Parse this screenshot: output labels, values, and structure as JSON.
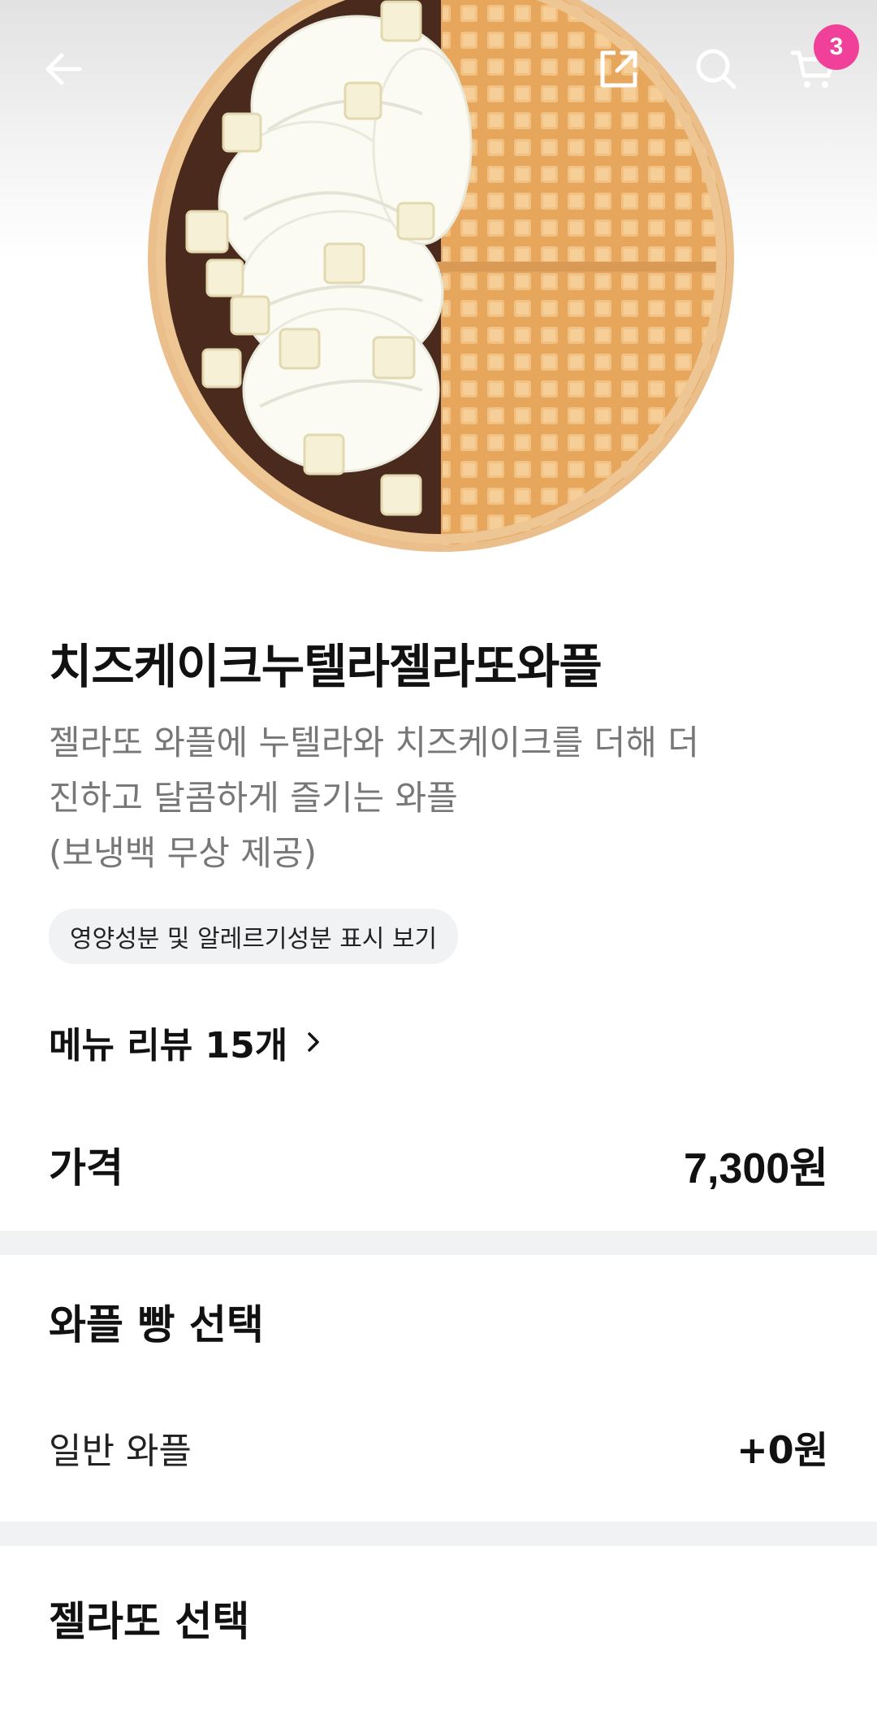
{
  "header": {
    "back_icon": "arrow-left-icon",
    "share_icon": "share-icon",
    "search_icon": "search-icon",
    "cart_icon": "cart-icon",
    "cart_count": "3",
    "badge_color": "#f0409a"
  },
  "product": {
    "image": "waffle-product-image",
    "name": "치즈케이크누텔라젤라또와플",
    "description": "젤라또 와플에 누텔라와 치즈케이크를 더해 더\n진하고 달콤하게 즐기는 와플\n(보냉백 무상 제공)",
    "nutrition_link": "영양성분 및 알레르기성분 표시 보기",
    "review_link": "메뉴 리뷰 15개"
  },
  "price": {
    "label": "가격",
    "value": "7,300원"
  },
  "option_groups": [
    {
      "title": "와플 빵 선택",
      "options": [
        {
          "name": "일반 와플",
          "price": "+0원"
        }
      ]
    },
    {
      "title": "젤라또 선택"
    }
  ]
}
